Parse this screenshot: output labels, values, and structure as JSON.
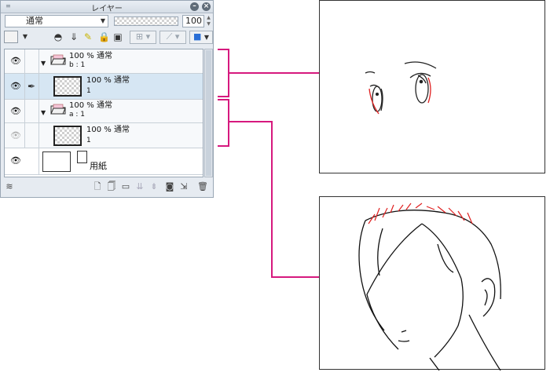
{
  "panel": {
    "title": "レイヤー",
    "blend_mode": "通常",
    "opacity": "100",
    "toolbar_icons": [
      "color-swatch-icon",
      "dropdown-icon",
      "mask-icon",
      "clip-icon",
      "pen-icon",
      "lock-icon",
      "lock-alpha-icon",
      "reference-icon",
      "ruler-icon",
      "layer-color-icon"
    ]
  },
  "layers": [
    {
      "kind": "folder",
      "opacity_mode": "100 % 通常",
      "name": "b : 1",
      "visible": true
    },
    {
      "kind": "raster",
      "opacity_mode": "100 % 通常",
      "name": "1",
      "visible": true,
      "selected": true,
      "editing": true
    },
    {
      "kind": "folder",
      "opacity_mode": "100 % 通常",
      "name": "a : 1",
      "visible": true
    },
    {
      "kind": "raster",
      "opacity_mode": "100 % 通常",
      "name": "1",
      "visible": false
    },
    {
      "kind": "paper",
      "name": "用紙",
      "visible": true
    }
  ],
  "bottom_icons": [
    "layer-palette-icon",
    "new-raster-icon",
    "new-vector-icon",
    "new-folder-icon",
    "move-down-icon",
    "merge-icon",
    "mask-add-icon",
    "apply-mask-icon",
    "delete-icon"
  ],
  "colors": {
    "bracket": "#d6197e",
    "selection": "#d6e6f3",
    "panel_bg": "#e6ebf1",
    "red_line": "#e02020"
  }
}
